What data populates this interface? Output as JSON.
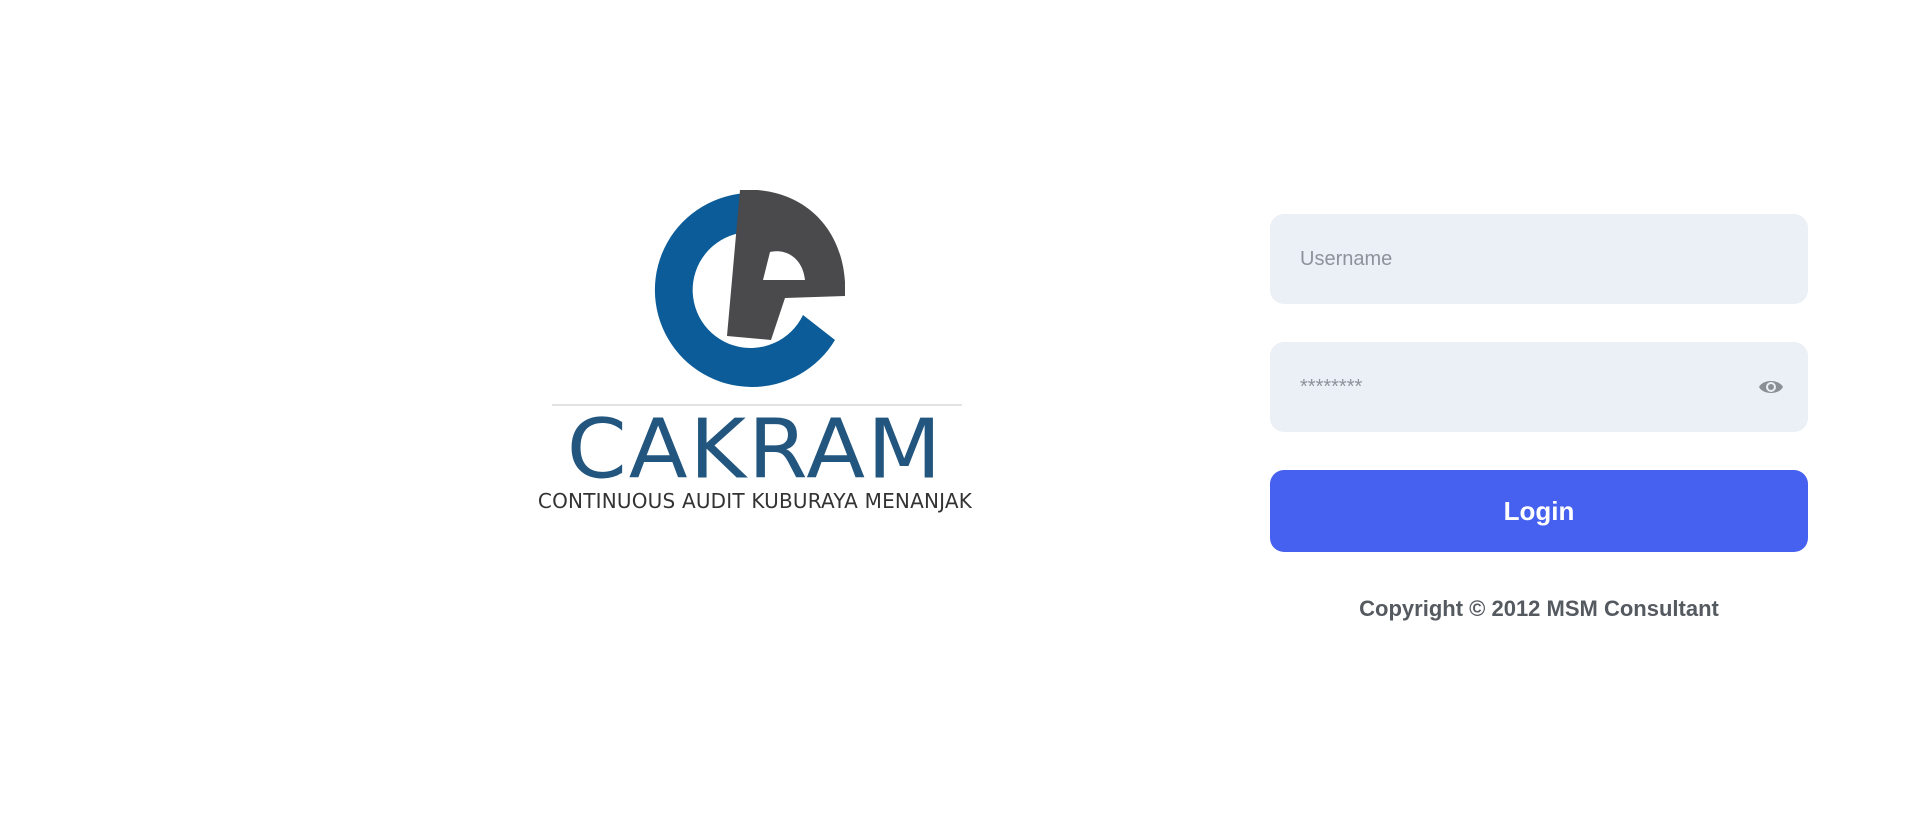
{
  "brand": {
    "name": "CAKRAM",
    "tagline": "CONTINUOUS AUDIT KUBURAYA MENANJAK",
    "colors": {
      "primary_blue": "#0b5c98",
      "dark_gray": "#4a4a4c",
      "text_blue": "#22567f"
    }
  },
  "login_form": {
    "username": {
      "placeholder": "Username",
      "value": ""
    },
    "password": {
      "placeholder": "********",
      "value": "",
      "toggle_icon": "eye-icon"
    },
    "submit_label": "Login",
    "accent_color": "#4661ef"
  },
  "footer": {
    "copyright": "Copyright © 2012 MSM Consultant"
  }
}
